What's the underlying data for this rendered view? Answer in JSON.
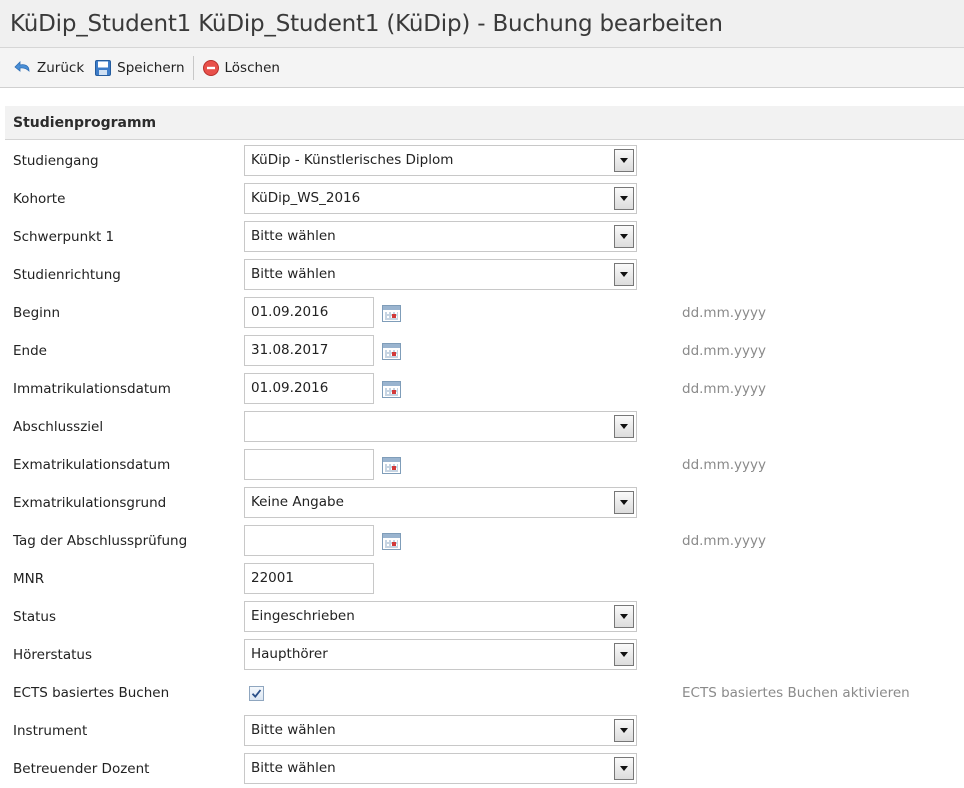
{
  "title": "KüDip_Student1 KüDip_Student1 (KüDip) - Buchung bearbeiten",
  "toolbar": {
    "back_label": "Zurück",
    "save_label": "Speichern",
    "delete_label": "Löschen"
  },
  "section": {
    "title": "Studienprogramm"
  },
  "form": {
    "studiengang": {
      "label": "Studiengang",
      "value": "KüDip - Künstlerisches Diplom"
    },
    "kohorte": {
      "label": "Kohorte",
      "value": "KüDip_WS_2016"
    },
    "schwerpunkt": {
      "label": "Schwerpunkt 1",
      "value": "Bitte wählen"
    },
    "studienrichtung": {
      "label": "Studienrichtung",
      "value": "Bitte wählen"
    },
    "beginn": {
      "label": "Beginn",
      "value": "01.09.2016",
      "hint": "dd.mm.yyyy"
    },
    "ende": {
      "label": "Ende",
      "value": "31.08.2017",
      "hint": "dd.mm.yyyy"
    },
    "immatrikulation": {
      "label": "Immatrikulationsdatum",
      "value": "01.09.2016",
      "hint": "dd.mm.yyyy"
    },
    "abschlussziel": {
      "label": "Abschlussziel",
      "value": ""
    },
    "exmatrikulation": {
      "label": "Exmatrikulationsdatum",
      "value": "",
      "hint": "dd.mm.yyyy"
    },
    "exmatrikulationsgrund": {
      "label": "Exmatrikulationsgrund",
      "value": "Keine Angabe"
    },
    "abschlusspruefung": {
      "label": "Tag der Abschlussprüfung",
      "value": "",
      "hint": "dd.mm.yyyy"
    },
    "mnr": {
      "label": "MNR",
      "value": "22001"
    },
    "status": {
      "label": "Status",
      "value": "Eingeschrieben"
    },
    "hoererstatus": {
      "label": "Hörerstatus",
      "value": "Haupthörer"
    },
    "ects": {
      "label": "ECTS basiertes Buchen",
      "checked": true,
      "hint": "ECTS basiertes Buchen aktivieren"
    },
    "instrument": {
      "label": "Instrument",
      "value": "Bitte wählen"
    },
    "dozent": {
      "label": "Betreuender Dozent",
      "value": "Bitte wählen"
    }
  }
}
